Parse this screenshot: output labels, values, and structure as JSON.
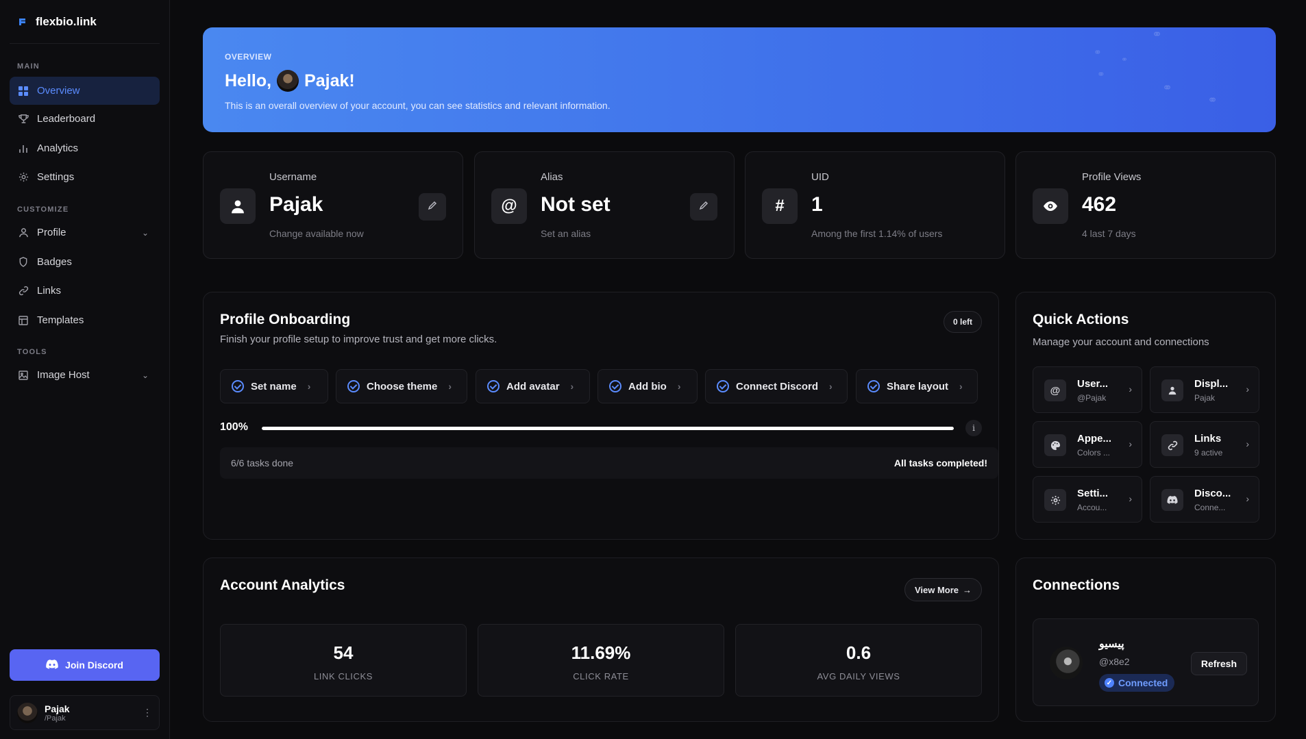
{
  "brand": {
    "name": "flexbio.link"
  },
  "sidebar": {
    "sections": {
      "main": "MAIN",
      "customize": "CUSTOMIZE",
      "tools": "TOOLS"
    },
    "items": [
      {
        "label": "Overview",
        "icon": "grid-icon",
        "active": true
      },
      {
        "label": "Leaderboard",
        "icon": "trophy-icon"
      },
      {
        "label": "Analytics",
        "icon": "bar-chart-icon"
      },
      {
        "label": "Settings",
        "icon": "gear-icon"
      },
      {
        "label": "Profile",
        "icon": "user-icon"
      },
      {
        "label": "Badges",
        "icon": "shield-icon"
      },
      {
        "label": "Links",
        "icon": "link-icon"
      },
      {
        "label": "Templates",
        "icon": "layout-icon"
      },
      {
        "label": "Image Host",
        "icon": "image-icon"
      }
    ],
    "join_discord": "Join Discord",
    "user": {
      "name": "Pajak",
      "handle": "/Pajak"
    }
  },
  "hero": {
    "label": "OVERVIEW",
    "greeting": "Hello,",
    "name": "Pajak!",
    "subtitle": "This is an overall overview of your account, you can see statistics and relevant information."
  },
  "stats": [
    {
      "label": "Username",
      "value": "Pajak",
      "sub": "Change available now",
      "icon": "user-icon",
      "editable": true
    },
    {
      "label": "Alias",
      "value": "Not set",
      "sub": "Set an alias",
      "icon": "at-icon",
      "editable": true
    },
    {
      "label": "UID",
      "value": "1",
      "sub": "Among the first 1.14% of users",
      "icon": "hash-icon",
      "editable": false
    },
    {
      "label": "Profile Views",
      "value": "462",
      "sub": "4 last 7 days",
      "icon": "eye-icon",
      "editable": false
    }
  ],
  "onboarding": {
    "title": "Profile Onboarding",
    "subtitle": "Finish your profile setup to improve trust and get more clicks.",
    "left_badge": "0 left",
    "tasks": [
      "Set name",
      "Choose theme",
      "Add avatar",
      "Add bio",
      "Connect Discord",
      "Share layout"
    ],
    "progress_label": "100%",
    "progress": 1.0,
    "tasks_done": "6/6 tasks done",
    "complete_text": "All tasks completed!"
  },
  "quick_actions": {
    "title": "Quick Actions",
    "subtitle": "Manage your account and connections",
    "items": [
      {
        "title": "User...",
        "sub": "@Pajak",
        "icon": "at-icon"
      },
      {
        "title": "Displ...",
        "sub": "Pajak",
        "icon": "user-icon"
      },
      {
        "title": "Appe...",
        "sub": "Colors ...",
        "icon": "palette-icon"
      },
      {
        "title": "Links",
        "sub": "9 active",
        "icon": "link-icon"
      },
      {
        "title": "Setti...",
        "sub": "Accou...",
        "icon": "gear-icon"
      },
      {
        "title": "Disco...",
        "sub": "Conne...",
        "icon": "discord-icon"
      }
    ]
  },
  "analytics": {
    "title": "Account Analytics",
    "view_more": "View More",
    "metrics": [
      {
        "value": "54",
        "label": "LINK CLICKS"
      },
      {
        "value": "11.69%",
        "label": "CLICK RATE"
      },
      {
        "value": "0.6",
        "label": "AVG DAILY VIEWS"
      }
    ]
  },
  "connections": {
    "title": "Connections",
    "name": "پیسیو",
    "handle": "@x8e2",
    "status": "Connected",
    "refresh": "Refresh"
  },
  "colors": {
    "accent": "#5b8cff",
    "discord": "#5865f2",
    "hero_start": "#4a88f0",
    "hero_end": "#3a5fe6"
  }
}
